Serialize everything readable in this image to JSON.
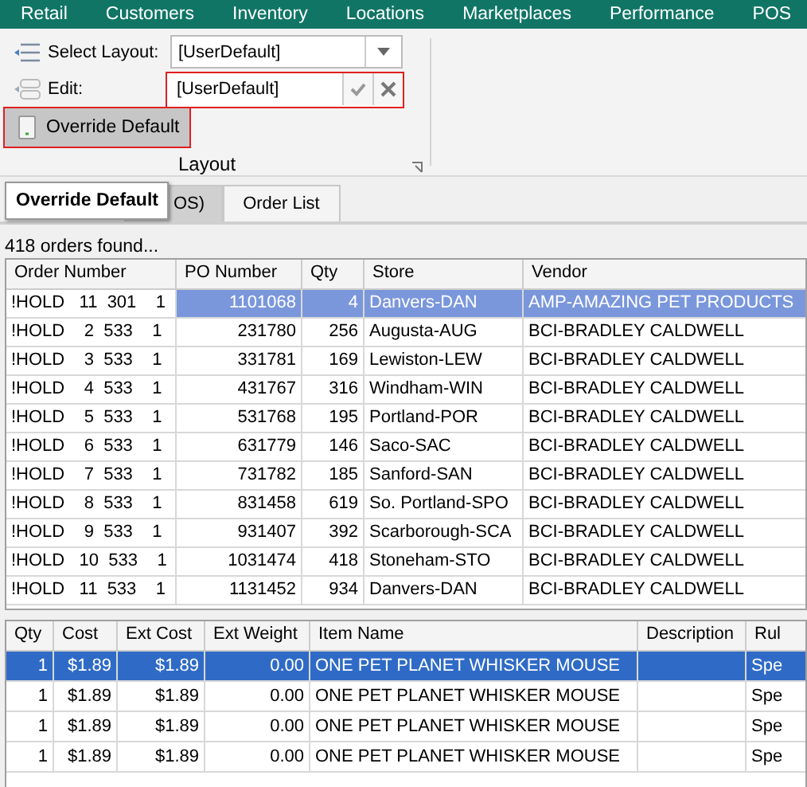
{
  "menu": [
    {
      "label": "Retail"
    },
    {
      "label": "Customers"
    },
    {
      "label": "Inventory"
    },
    {
      "label": "Locations"
    },
    {
      "label": "Marketplaces"
    },
    {
      "label": "Performance"
    },
    {
      "label": "POS"
    }
  ],
  "ribbon": {
    "select_layout": {
      "label": "Select Layout:",
      "value": "[UserDefault]"
    },
    "edit": {
      "label": "Edit:",
      "value": "[UserDefault]",
      "highlighted": true
    },
    "override_button": {
      "label": "Override Default",
      "pressed": true,
      "highlighted": true
    },
    "group_label": "Layout"
  },
  "tabs": [
    {
      "label": "OS)",
      "selected": true
    },
    {
      "label": "Order List",
      "selected": false
    }
  ],
  "tooltip": "Override Default",
  "status": "418 orders found...",
  "orders": {
    "columns": [
      "Order Number",
      "PO Number",
      "Qty",
      "Store",
      "Vendor"
    ],
    "rows": [
      {
        "selected": true,
        "cells": [
          "!HOLD   11  301    1",
          "1101068",
          "4",
          "Danvers-DAN",
          "AMP-AMAZING PET PRODUCTS"
        ]
      },
      {
        "selected": false,
        "cells": [
          "!HOLD    2  533    1",
          "231780",
          "256",
          "Augusta-AUG",
          "BCI-BRADLEY CALDWELL"
        ]
      },
      {
        "selected": false,
        "cells": [
          "!HOLD    3  533    1",
          "331781",
          "169",
          "Lewiston-LEW",
          "BCI-BRADLEY CALDWELL"
        ]
      },
      {
        "selected": false,
        "cells": [
          "!HOLD    4  533    1",
          "431767",
          "316",
          "Windham-WIN",
          "BCI-BRADLEY CALDWELL"
        ]
      },
      {
        "selected": false,
        "cells": [
          "!HOLD    5  533    1",
          "531768",
          "195",
          "Portland-POR",
          "BCI-BRADLEY CALDWELL"
        ]
      },
      {
        "selected": false,
        "cells": [
          "!HOLD    6  533    1",
          "631779",
          "146",
          "Saco-SAC",
          "BCI-BRADLEY CALDWELL"
        ]
      },
      {
        "selected": false,
        "cells": [
          "!HOLD    7  533    1",
          "731782",
          "185",
          "Sanford-SAN",
          "BCI-BRADLEY CALDWELL"
        ]
      },
      {
        "selected": false,
        "cells": [
          "!HOLD    8  533    1",
          "831458",
          "619",
          "So. Portland-SPO",
          "BCI-BRADLEY CALDWELL"
        ]
      },
      {
        "selected": false,
        "cells": [
          "!HOLD    9  533    1",
          "931407",
          "392",
          "Scarborough-SCA",
          "BCI-BRADLEY CALDWELL"
        ]
      },
      {
        "selected": false,
        "cells": [
          "!HOLD   10  533    1",
          "1031474",
          "418",
          "Stoneham-STO",
          "BCI-BRADLEY CALDWELL"
        ]
      },
      {
        "selected": false,
        "cells": [
          "!HOLD   11  533    1",
          "1131452",
          "934",
          "Danvers-DAN",
          "BCI-BRADLEY CALDWELL"
        ]
      }
    ]
  },
  "items": {
    "columns": [
      "Qty",
      "Cost",
      "Ext Cost",
      "Ext Weight",
      "Item Name",
      "Description",
      "Rul"
    ],
    "rows": [
      {
        "selected": true,
        "cells": [
          "1",
          "$1.89",
          "$1.89",
          "0.00",
          "ONE PET PLANET WHISKER MOUSE",
          "",
          "Spe"
        ]
      },
      {
        "selected": false,
        "cells": [
          "1",
          "$1.89",
          "$1.89",
          "0.00",
          "ONE PET PLANET WHISKER MOUSE",
          "",
          "Spe"
        ]
      },
      {
        "selected": false,
        "cells": [
          "1",
          "$1.89",
          "$1.89",
          "0.00",
          "ONE PET PLANET WHISKER MOUSE",
          "",
          "Spe"
        ]
      },
      {
        "selected": false,
        "cells": [
          "1",
          "$1.89",
          "$1.89",
          "0.00",
          "ONE PET PLANET WHISKER MOUSE",
          "",
          "Spe"
        ]
      }
    ]
  }
}
